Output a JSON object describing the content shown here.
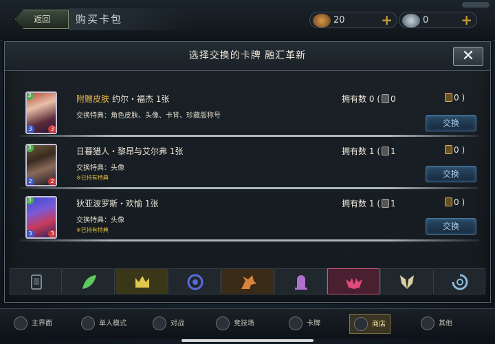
{
  "topbar": {
    "back_label": "返回",
    "page_title": "购买卡包",
    "currency_1": "20",
    "currency_2": "0",
    "plus": "+"
  },
  "modal": {
    "title": "选择交换的卡牌 融汇革新",
    "close_glyph": "✕",
    "items": [
      {
        "gift_label": "附赠皮肤",
        "name": "约尔・福杰 1张",
        "owned_label": "拥有数",
        "owned_count": "0",
        "owned_alt": "(",
        "owned_silver": "0",
        "owned_gold": "0",
        "owned_close": ")",
        "bonus": "交换特典：角色皮肤、头像、卡背、珍藏版称号",
        "owned_note": "",
        "card_cost": "3",
        "card_atk": "3",
        "card_hp": "3",
        "button": "交换"
      },
      {
        "gift_label": "",
        "name": "日暮猎人・黎昂与艾尔弗 1张",
        "owned_label": "拥有数",
        "owned_count": "1",
        "owned_alt": "(",
        "owned_silver": "1",
        "owned_gold": "0",
        "owned_close": ")",
        "bonus": "交换特典：头像",
        "owned_note": "※已持有特典",
        "card_cost": "3",
        "card_atk": "2",
        "card_hp": "2",
        "button": "交换"
      },
      {
        "gift_label": "",
        "name": "狄亚波罗斯・欢愉 1张",
        "owned_label": "拥有数",
        "owned_count": "1",
        "owned_alt": "(",
        "owned_silver": "1",
        "owned_gold": "0",
        "owned_close": ")",
        "bonus": "交换特典：头像",
        "owned_note": "※已持有特典",
        "card_cost": "3",
        "card_atk": "3",
        "card_hp": "3",
        "button": "交换"
      }
    ]
  },
  "tabs": [
    {
      "name": "neutral-tab-icon",
      "color": "#7c8a94"
    },
    {
      "name": "forest-tab-icon",
      "color": "#5ec85e"
    },
    {
      "name": "sword-tab-icon",
      "color": "#e0c850"
    },
    {
      "name": "rune-tab-icon",
      "color": "#5a6adc"
    },
    {
      "name": "dragon-tab-icon",
      "color": "#d8843a"
    },
    {
      "name": "shadow-tab-icon",
      "color": "#b070d0"
    },
    {
      "name": "blood-tab-icon",
      "color": "#e04a7a"
    },
    {
      "name": "haven-tab-icon",
      "color": "#d8cca0"
    },
    {
      "name": "portal-tab-icon",
      "color": "#8ab8d8"
    }
  ],
  "bottomnav": [
    {
      "label": "主界面"
    },
    {
      "label": "单人模式"
    },
    {
      "label": "对战"
    },
    {
      "label": "竞技场"
    },
    {
      "label": "卡牌"
    },
    {
      "label": "商店"
    },
    {
      "label": "其他"
    }
  ]
}
